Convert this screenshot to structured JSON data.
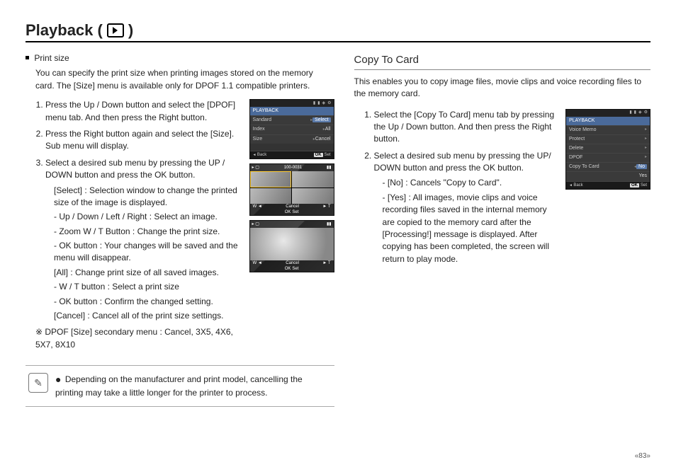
{
  "page": {
    "title_prefix": "Playback (",
    "title_suffix": ")",
    "number_display": "«83»"
  },
  "left": {
    "heading": "Print size",
    "intro": "You can specify the print size when printing images stored on the memory card. The [Size] menu is available only for DPOF 1.1 compatible printers.",
    "steps": {
      "s1": "Press the Up / Down button and select the [DPOF] menu tab. And then press the Right button.",
      "s2": "Press the Right button again and select the [Size]. Sub menu will display.",
      "s3": "Select a desired sub menu by pressing the UP / DOWN button and press the OK button.",
      "select_label": "[Select] :",
      "select_text": "Selection window to change the printed size of the image is displayed.",
      "nav": "- Up / Down / Left / Right : Select an image.",
      "zoom": "- Zoom W / T Button : Change the print size.",
      "okbtn": "- OK button : Your changes will be saved and the menu will disappear.",
      "all_label": "[All] :",
      "all_text": "Change print size of all saved images.",
      "wt": "- W / T button : Select a print size",
      "okconfirm": "- OK button : Confirm the changed setting.",
      "cancel_label": "[Cancel] :",
      "cancel_text": "Cancel all of the print size settings."
    },
    "secondary_label": "※ DPOF [Size] secondary menu : Cancel, 3X5, 4X6, 5X7, 8X10",
    "note": "Depending on the manufacturer and print model, cancelling the printing may take a little longer for the printer to process.",
    "lcd1": {
      "header": "PLAYBACK",
      "rows": [
        {
          "lab": "Sandard",
          "val": "Select"
        },
        {
          "lab": "Index",
          "val": "All"
        },
        {
          "lab": "Size",
          "val": "Cancel"
        }
      ],
      "back": "Back",
      "set": "Set",
      "ok": "OK"
    },
    "lcd2": {
      "counter": "100-0031",
      "w": "W ◄",
      "cancel": "Cancel",
      "t": "► T",
      "ok": "OK",
      "set": "Set"
    },
    "lcd3": {
      "w": "W ◄",
      "cancel": "Cancel",
      "t": "► T",
      "ok": "OK",
      "set": "Set"
    }
  },
  "right": {
    "heading": "Copy To Card",
    "intro": "This enables you to copy image files, movie clips and voice recording files to the memory card.",
    "steps": {
      "s1": "Select the [Copy To Card] menu tab by pressing the Up / Down button. And then press the Right button.",
      "s2": "Select a desired sub menu by pressing the UP/ DOWN button and press the OK button.",
      "no_label": "- [No] :",
      "no_text": "Cancels \"Copy to Card\".",
      "yes_label": "- [Yes] :",
      "yes_text": "All images, movie clips and voice recording files saved in the internal memory are copied to the memory card after the [Processing!] message is displayed. After copying has been completed, the screen will return to play mode."
    },
    "lcd": {
      "header": "PLAYBACK",
      "rows": [
        {
          "lab": "Voice Memo",
          "val": ""
        },
        {
          "lab": "Protect",
          "val": ""
        },
        {
          "lab": "Delete",
          "val": ""
        },
        {
          "lab": "DPOF",
          "val": ""
        },
        {
          "lab": "Copy To Card",
          "val": "No"
        },
        {
          "lab": "",
          "val": "Yes"
        }
      ],
      "back": "Back",
      "set": "Set",
      "ok": "OK"
    }
  }
}
